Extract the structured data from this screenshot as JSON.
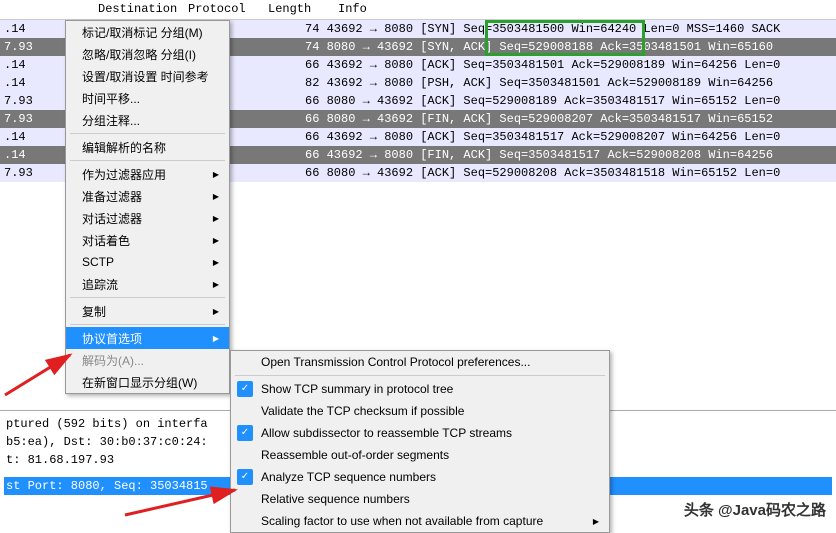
{
  "columns": {
    "destination": "Destination",
    "protocol": "Protocol",
    "length": "Length",
    "info": "Info"
  },
  "packets": [
    {
      "ip": ".14",
      "cls": "row-light",
      "info": "74 43692 → 8080 [SYN] Seq=3503481500 Win=64240 Len=0 MSS=1460 SACK"
    },
    {
      "ip": "7.93",
      "cls": "row-dark",
      "info": "74 8080 → 43692 [SYN, ACK] Seq=529008188 Ack=3503481501 Win=65160"
    },
    {
      "ip": ".14",
      "cls": "row-light",
      "info": "66 43692 → 8080 [ACK] Seq=3503481501 Ack=529008189 Win=64256 Len=0"
    },
    {
      "ip": ".14",
      "cls": "row-light",
      "info": "82 43692 → 8080 [PSH, ACK] Seq=3503481501 Ack=529008189 Win=64256"
    },
    {
      "ip": "7.93",
      "cls": "row-light",
      "info": "66 8080 → 43692 [ACK] Seq=529008189 Ack=3503481517 Win=65152 Len=0"
    },
    {
      "ip": "7.93",
      "cls": "row-dark",
      "info": "66 8080 → 43692 [FIN, ACK] Seq=529008207 Ack=3503481517 Win=65152"
    },
    {
      "ip": ".14",
      "cls": "row-light",
      "info": "66 43692 → 8080 [ACK] Seq=3503481517 Ack=529008207 Win=64256 Len=0"
    },
    {
      "ip": ".14",
      "cls": "row-dark",
      "info": "66 43692 → 8080 [FIN, ACK] Seq=3503481517 Ack=529008208 Win=64256"
    },
    {
      "ip": "7.93",
      "cls": "row-light",
      "info": "66 8080 → 43692 [ACK] Seq=529008208 Ack=3503481518 Win=65152 Len=0"
    }
  ],
  "menu": {
    "mark": "标记/取消标记 分组(M)",
    "ignore": "忽略/取消忽略 分组(I)",
    "settime": "设置/取消设置 时间参考",
    "timeshift": "时间平移...",
    "comment": "分组注释...",
    "editname": "编辑解析的名称",
    "asfilter": "作为过滤器应用",
    "prepfilter": "准备过滤器",
    "conversation": "对话过滤器",
    "colorize": "对话着色",
    "sctp": "SCTP",
    "follow": "追踪流",
    "copy": "复制",
    "protoprefs": "协议首选项",
    "decode": "解码为(A)...",
    "newwindow": "在新窗口显示分组(W)"
  },
  "submenu": {
    "open": "Open Transmission Control Protocol preferences...",
    "summary": "Show TCP summary in protocol tree",
    "validate": "Validate the TCP checksum if possible",
    "subdissector": "Allow subdissector to reassemble TCP streams",
    "reassemble": "Reassemble out-of-order segments",
    "analyze": "Analyze TCP sequence numbers",
    "relative": "Relative sequence numbers",
    "scaling": "Scaling factor to use when not available from capture"
  },
  "detail": {
    "line1": "ptured (592 bits) on interfa",
    "line2": "b5:ea), Dst: 30:b0:37:c0:24:",
    "line3": "t: 81.68.197.93",
    "line4": "st Port: 8080, Seq: 35034815"
  },
  "watermark": "头条 @Java码农之路"
}
